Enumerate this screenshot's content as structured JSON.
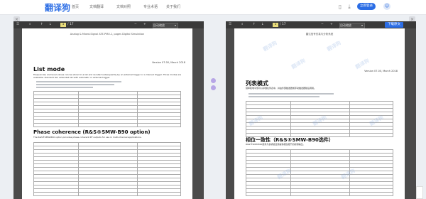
{
  "app": {
    "logo": "翻译狗",
    "login_label": "立即登录",
    "avatar_glyph": "☺"
  },
  "nav": [
    "首页",
    "文档翻译",
    "文档对照",
    "专业术语",
    "关于我们"
  ],
  "viewer_left": {
    "toolbar": {
      "page": "1",
      "page_total": "/ 17",
      "mode": "自动缩放"
    },
    "header_text": "Analog & Mixed-Signal ATE-PMU-1, pages Digital Simulation",
    "version": "Version 07.00, March 2018",
    "h_list": "List mode",
    "p_list": "Frequencies and level values can be stored in a list and recalled subsequently by an external trigger or a manual trigger. Three modes are available: standard list, extended list with automatic or external trigger.",
    "h_phase": "Phase coherence (R&S®SMW-B90 option)",
    "p_phase": "The R&S®SMW-B90 option provides phase-coherent RF outputs for use in multi-channel applications."
  },
  "viewer_right": {
    "toolbar": {
      "page": "1",
      "page_total": "/ 17",
      "mode": "自动缩放",
      "download_label": "下载原文"
    },
    "header_text": "雷达信号仿真与分析系统",
    "version": "Version 07.00, March 2018",
    "h_list": "列表模式",
    "p_list": "频率和电平值可以存储在列表中，并由外部触发器或手动触发器随后调用。",
    "h_phase": "相位一致性（R&S®SMW-B90选件）",
    "p_phase": "R&S®SMW-B90选件为多通道应用提供相位相干的射频输出。"
  },
  "watermark": "翻译狗"
}
